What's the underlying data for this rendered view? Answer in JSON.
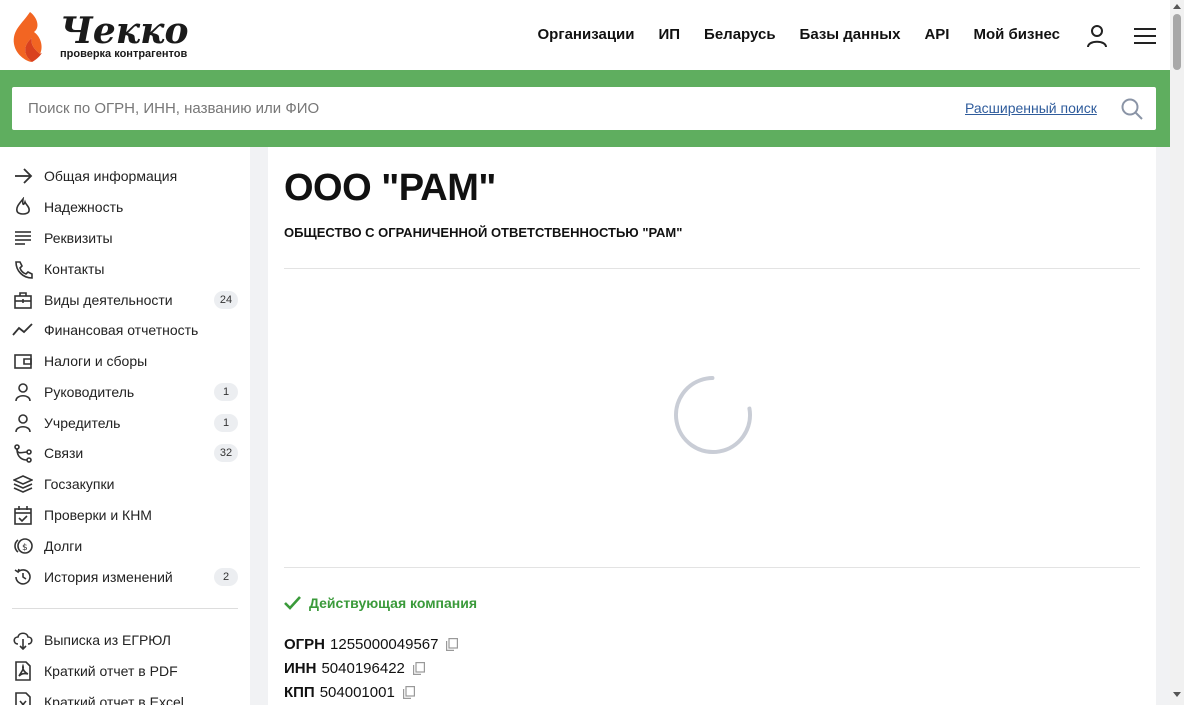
{
  "brand": {
    "name": "Чекко",
    "tagline": "проверка контрагентов",
    "colors": {
      "flame_orange": "#f26522",
      "flame_red": "#d9411e",
      "accent_green": "#5fae5f",
      "status_green": "#3a9a3a",
      "link_blue": "#2f5c9c"
    }
  },
  "nav": {
    "items": [
      "Организации",
      "ИП",
      "Беларусь",
      "Базы данных",
      "API",
      "Мой бизнес"
    ],
    "icons": [
      "user-icon",
      "menu-icon"
    ]
  },
  "search": {
    "placeholder": "Поиск по ОГРН, ИНН, названию или ФИО",
    "value": "",
    "advanced_label": "Расширенный поиск"
  },
  "sidebar": {
    "items": [
      {
        "label": "Общая информация",
        "icon": "arrow-right-icon",
        "badge": ""
      },
      {
        "label": "Надежность",
        "icon": "flame-icon",
        "badge": ""
      },
      {
        "label": "Реквизиты",
        "icon": "lines-icon",
        "badge": ""
      },
      {
        "label": "Контакты",
        "icon": "phone-icon",
        "badge": ""
      },
      {
        "label": "Виды деятельности",
        "icon": "briefcase-icon",
        "badge": "24"
      },
      {
        "label": "Финансовая отчетность",
        "icon": "chart-line-icon",
        "badge": ""
      },
      {
        "label": "Налоги и сборы",
        "icon": "wallet-icon",
        "badge": ""
      },
      {
        "label": "Руководитель",
        "icon": "person-icon",
        "badge": "1"
      },
      {
        "label": "Учредитель",
        "icon": "person-icon",
        "badge": "1"
      },
      {
        "label": "Связи",
        "icon": "branch-icon",
        "badge": "32"
      },
      {
        "label": "Госзакупки",
        "icon": "layers-icon",
        "badge": ""
      },
      {
        "label": "Проверки и КНМ",
        "icon": "calendar-check-icon",
        "badge": ""
      },
      {
        "label": "Долги",
        "icon": "coins-icon",
        "badge": ""
      },
      {
        "label": "История изменений",
        "icon": "history-icon",
        "badge": "2"
      }
    ],
    "downloads": [
      {
        "label": "Выписка из ЕГРЮЛ",
        "icon": "cloud-download-icon"
      },
      {
        "label": "Краткий отчет в PDF",
        "icon": "pdf-icon"
      },
      {
        "label": "Краткий отчет в Excel",
        "icon": "excel-icon"
      }
    ]
  },
  "company": {
    "short_name": "ООО \"РАМ\"",
    "full_name": "ОБЩЕСТВО С ОГРАНИЧЕННОЙ ОТВЕТСТВЕННОСТЬЮ \"РАМ\"",
    "status": "Действующая компания",
    "requisites": [
      {
        "label": "ОГРН",
        "value": "1255000049567"
      },
      {
        "label": "ИНН",
        "value": "5040196422"
      },
      {
        "label": "КПП",
        "value": "504001001"
      }
    ]
  }
}
